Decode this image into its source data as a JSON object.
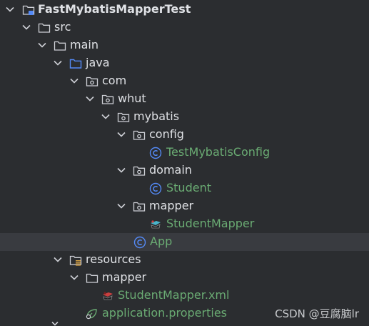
{
  "tree": {
    "nodes": [
      {
        "label": "FastMybatisMapperTest",
        "icon": "module-folder-icon",
        "expanded": true,
        "bold": true
      },
      {
        "label": "src",
        "icon": "folder-icon",
        "expanded": true
      },
      {
        "label": "main",
        "icon": "folder-icon",
        "expanded": true
      },
      {
        "label": "java",
        "icon": "source-root-folder-icon",
        "expanded": true
      },
      {
        "label": "com",
        "icon": "package-icon",
        "expanded": true
      },
      {
        "label": "whut",
        "icon": "package-icon",
        "expanded": true
      },
      {
        "label": "mybatis",
        "icon": "package-icon",
        "expanded": true
      },
      {
        "label": "config",
        "icon": "package-icon",
        "expanded": true
      },
      {
        "label": "TestMybatisConfig",
        "icon": "class-icon",
        "color": "green"
      },
      {
        "label": "domain",
        "icon": "package-icon",
        "expanded": true
      },
      {
        "label": "Student",
        "icon": "class-icon",
        "color": "green"
      },
      {
        "label": "mapper",
        "icon": "package-icon",
        "expanded": true
      },
      {
        "label": "StudentMapper",
        "icon": "mybatis-mapper-icon",
        "color": "green"
      },
      {
        "label": "App",
        "icon": "class-icon",
        "color": "green",
        "selected": true
      },
      {
        "label": "resources",
        "icon": "resources-folder-icon",
        "expanded": true
      },
      {
        "label": "mapper",
        "icon": "folder-icon",
        "expanded": true
      },
      {
        "label": "StudentMapper.xml",
        "icon": "mybatis-xml-icon",
        "color": "green"
      },
      {
        "label": "application.properties",
        "icon": "spring-properties-icon",
        "color": "green"
      }
    ]
  },
  "watermark": "CSDN @豆腐脑lr",
  "colors": {
    "background": "#2b2d30",
    "selected": "#393b40",
    "text": "#dfe1e5",
    "green": "#6aab73",
    "class_icon": "#548af7",
    "folder_outline": "#ced0d6"
  }
}
